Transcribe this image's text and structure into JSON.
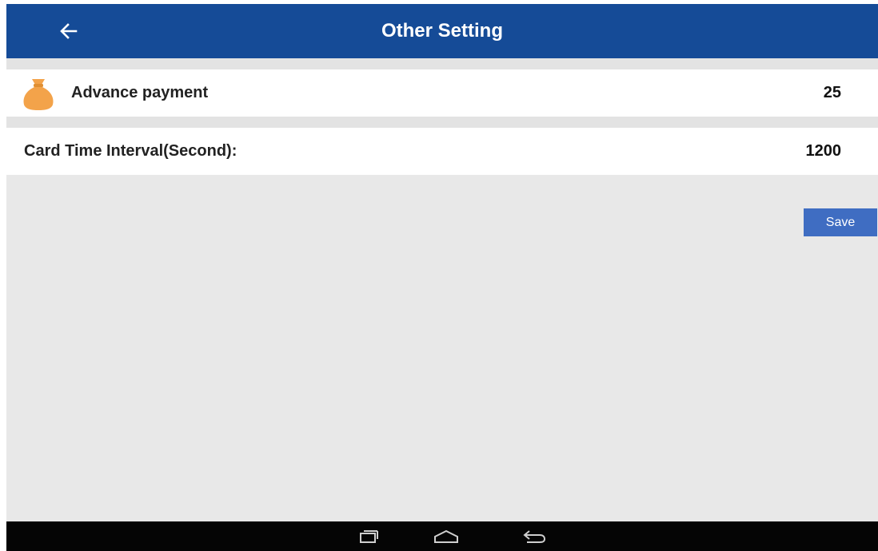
{
  "header": {
    "title": "Other Setting",
    "back_icon": "arrow-left-icon",
    "background": "#154b97"
  },
  "settings": [
    {
      "icon": "money-bag-icon",
      "label": "Advance payment",
      "value": "25"
    },
    {
      "label": "Card Time Interval(Second):",
      "value": "1200"
    }
  ],
  "actions": {
    "save_label": "Save",
    "save_color": "#3f6dc2"
  },
  "system_nav": {
    "icons": [
      "recent-apps-icon",
      "home-icon",
      "back-icon"
    ]
  }
}
